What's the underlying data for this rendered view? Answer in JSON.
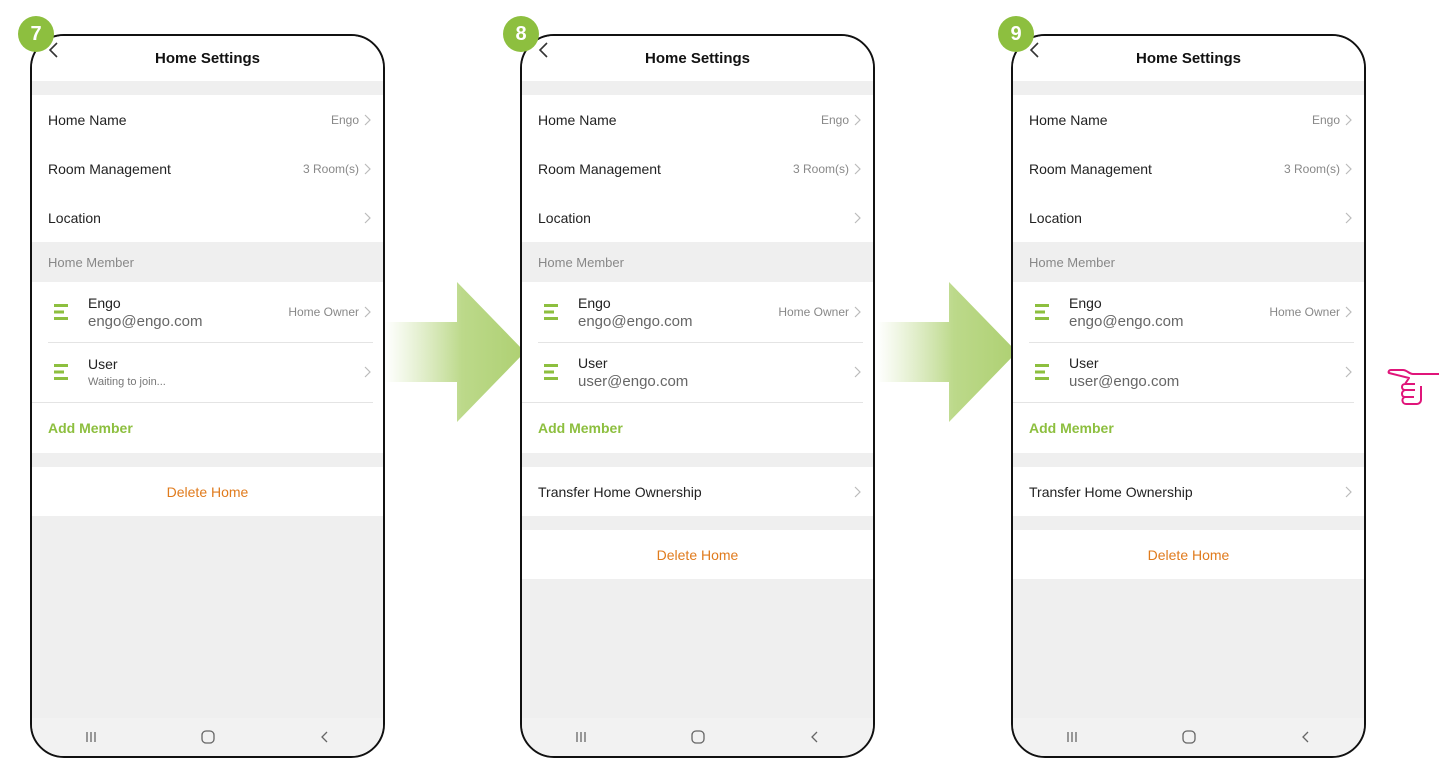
{
  "colors": {
    "accent": "#8dbf3f",
    "delete": "#e07b1d",
    "hand": "#e0157a"
  },
  "screens": [
    {
      "step": "7",
      "title": "Home Settings",
      "rows": [
        {
          "label": "Home Name",
          "value": "Engo"
        },
        {
          "label": "Room Management",
          "value": "3 Room(s)"
        },
        {
          "label": "Location",
          "value": ""
        }
      ],
      "member_header": "Home Member",
      "members": [
        {
          "name": "Engo",
          "sub": "engo@engo.com",
          "role": "Home Owner"
        },
        {
          "name": "User",
          "sub": "Waiting to join...",
          "role": ""
        }
      ],
      "add_member": "Add Member",
      "transfer": "",
      "delete": "Delete Home"
    },
    {
      "step": "8",
      "title": "Home Settings",
      "rows": [
        {
          "label": "Home Name",
          "value": "Engo"
        },
        {
          "label": "Room Management",
          "value": "3 Room(s)"
        },
        {
          "label": "Location",
          "value": ""
        }
      ],
      "member_header": "Home Member",
      "members": [
        {
          "name": "Engo",
          "sub": "engo@engo.com",
          "role": "Home Owner"
        },
        {
          "name": "User",
          "sub": "user@engo.com",
          "role": ""
        }
      ],
      "add_member": "Add Member",
      "transfer": "Transfer Home Ownership",
      "delete": "Delete Home"
    },
    {
      "step": "9",
      "title": "Home Settings",
      "rows": [
        {
          "label": "Home Name",
          "value": "Engo"
        },
        {
          "label": "Room Management",
          "value": "3 Room(s)"
        },
        {
          "label": "Location",
          "value": ""
        }
      ],
      "member_header": "Home Member",
      "members": [
        {
          "name": "Engo",
          "sub": "engo@engo.com",
          "role": "Home Owner"
        },
        {
          "name": "User",
          "sub": "user@engo.com",
          "role": ""
        }
      ],
      "add_member": "Add Member",
      "transfer": "Transfer Home Ownership",
      "delete": "Delete Home"
    }
  ]
}
